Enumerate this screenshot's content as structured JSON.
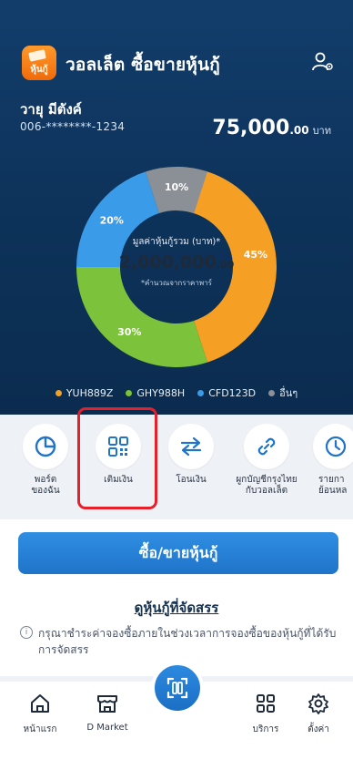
{
  "header": {
    "app_title": "วอลเล็ต ซื้อขายหุ้นกู้",
    "logo_text": "หุ้นกู้",
    "settings_icon": "user-settings-icon"
  },
  "account": {
    "name": "วายุ มีตังค์",
    "number": "006-********-1234",
    "balance_main": "75,000",
    "balance_decimals": ".00",
    "currency": "บาท"
  },
  "portfolio": {
    "center_label": "มูลค่าหุ้นกู้รวม (บาท)*",
    "total_main": "2,000,000",
    "total_decimals": ".00",
    "note": "*คำนวณจากราคาพาร์",
    "slices": [
      {
        "name": "YUH889Z",
        "percent": 45,
        "label": "45%",
        "color": "#f5a024"
      },
      {
        "name": "GHY988H",
        "percent": 30,
        "label": "30%",
        "color": "#7cc23a"
      },
      {
        "name": "CFD123D",
        "percent": 20,
        "label": "20%",
        "color": "#3a9be8"
      },
      {
        "name": "อื่นๆ",
        "percent": 10,
        "label": "10%",
        "color": "#8b8f96"
      }
    ]
  },
  "legend": [
    {
      "label": "YUH889Z",
      "color": "#f5a024"
    },
    {
      "label": "GHY988H",
      "color": "#7cc23a"
    },
    {
      "label": "CFD123D",
      "color": "#3a9be8"
    },
    {
      "label": "อื่นๆ",
      "color": "#8b8f96"
    }
  ],
  "menu": [
    {
      "label": "พอร์ต\nของฉัน",
      "icon": "pie-chart-icon"
    },
    {
      "label": "เติมเงิน",
      "icon": "qr-code-icon"
    },
    {
      "label": "โอนเงิน",
      "icon": "transfer-arrows-icon"
    },
    {
      "label": "ผูกบัญชีกรุงไทย\nกับวอลเล็ต",
      "icon": "link-icon"
    },
    {
      "label": "รายกา\nย้อนหล",
      "icon": "clock-icon"
    }
  ],
  "actions": {
    "buy_sell": "ซื้อ/ขายหุ้นกู้",
    "allotted_link": "ดูหุ้นกู้ที่จัดสรร",
    "notice": "กรุณาชำระค่าจองซื้อภายในช่วงเวลาการจองซื้อของหุ้นกู้ที่ได้รับการจัดสรร"
  },
  "tabbar": [
    {
      "label": "หน้าแรก",
      "icon": "home-icon"
    },
    {
      "label": "D Market",
      "icon": "store-icon"
    },
    {
      "label": "",
      "icon": "scan-icon"
    },
    {
      "label": "บริการ",
      "icon": "grid-icon"
    },
    {
      "label": "ตั้งค่า",
      "icon": "gear-icon"
    }
  ],
  "colors": {
    "hero_bg": "#0d3259",
    "accent": "#1f74c9",
    "highlight": "#e5202a"
  }
}
